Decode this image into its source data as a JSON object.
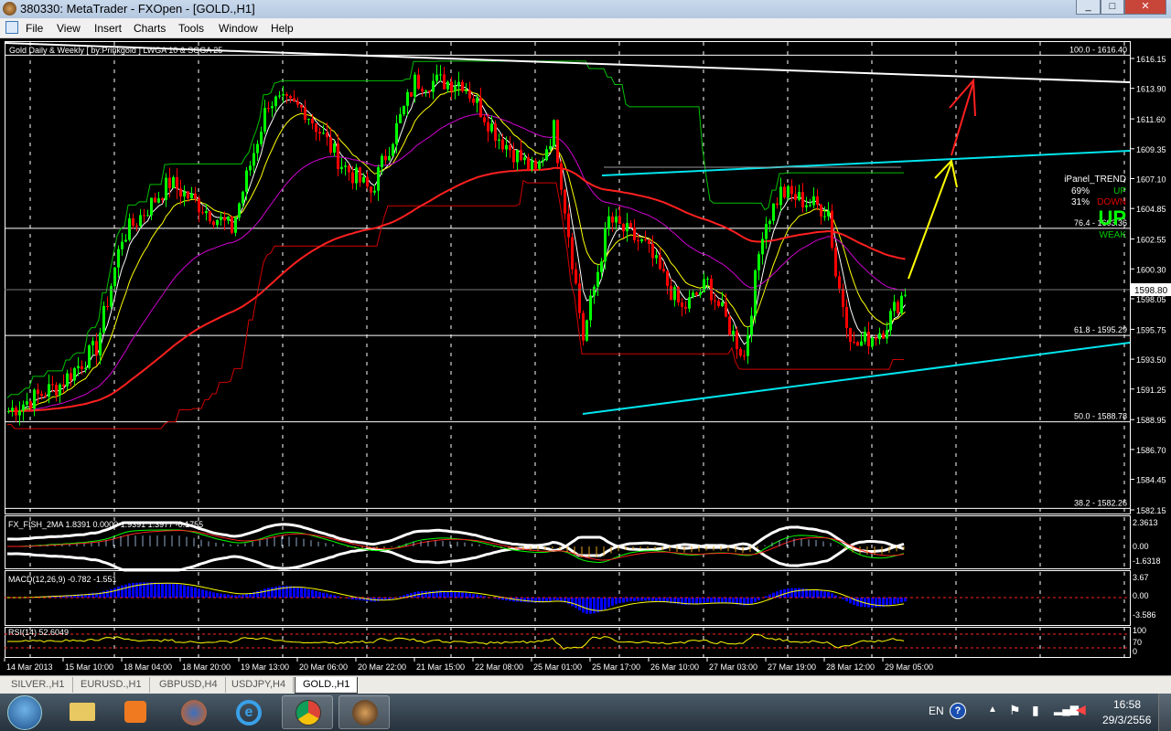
{
  "window": {
    "title": "380330: MetaTrader - FXOpen - [GOLD.,H1]",
    "min": "_",
    "max": "□",
    "close": "✕"
  },
  "menu": [
    "File",
    "View",
    "Insert",
    "Charts",
    "Tools",
    "Window",
    "Help"
  ],
  "chart": {
    "indicator_label": "Gold Daily & Weekly [ by:Prinkgold ] LWGA 10 & SGGA 25",
    "price_ticks": [
      "1616.15",
      "1613.90",
      "1611.60",
      "1609.35",
      "1607.10",
      "1604.85",
      "1602.55",
      "1600.30",
      "1598.05",
      "1595.75",
      "1593.50",
      "1591.25",
      "1588.95",
      "1586.70",
      "1584.45",
      "1582.15"
    ],
    "current_price": "1598.80",
    "fib_levels": [
      {
        "label": "100.0 - 1616.40",
        "price": 1616.4
      },
      {
        "label": "76.4 - 1603.36",
        "price": 1603.36
      },
      {
        "label": "61.8 - 1595.29",
        "price": 1595.29
      },
      {
        "label": "50.0 - 1588.78",
        "price": 1588.78
      },
      {
        "label": "38.2 - 1582.26",
        "price": 1582.26
      }
    ],
    "ipanel": {
      "title": "iPanel_TREND",
      "up_pct": "69%",
      "up": "UP",
      "down_pct": "31%",
      "down": "DOWN",
      "signal": "UP",
      "strength": "WEAK"
    },
    "time_labels": [
      "14 Mar 2013",
      "15 Mar 10:00",
      "18 Mar 04:00",
      "18 Mar 20:00",
      "19 Mar 13:00",
      "20 Mar 06:00",
      "20 Mar 22:00",
      "21 Mar 15:00",
      "22 Mar 08:00",
      "25 Mar 01:00",
      "25 Mar 17:00",
      "26 Mar 10:00",
      "27 Mar 03:00",
      "27 Mar 19:00",
      "28 Mar 12:00",
      "29 Mar 05:00"
    ],
    "colors": {
      "up": "#00ff00",
      "down": "#ff0000",
      "trend": "#00e5ee",
      "arrow_up": "#ffff00",
      "arrow_target": "#ff2020"
    }
  },
  "chart_data": {
    "type": "candlestick",
    "symbol": "GOLD.",
    "timeframe": "H1",
    "ylim": [
      1582.15,
      1616.15
    ],
    "close_waypoints": [
      [
        0,
        1589.6
      ],
      [
        14,
        1591.6
      ],
      [
        24,
        1594.4
      ],
      [
        31,
        1602.7
      ],
      [
        44,
        1606.8
      ],
      [
        61,
        1603.3
      ],
      [
        71,
        1613
      ],
      [
        81,
        1612.3
      ],
      [
        91,
        1608.2
      ],
      [
        99,
        1606.1
      ],
      [
        111,
        1614.4
      ],
      [
        124,
        1614.4
      ],
      [
        134,
        1610.2
      ],
      [
        144,
        1607.5
      ],
      [
        149,
        1610.9
      ],
      [
        157,
        1595.1
      ],
      [
        164,
        1604
      ],
      [
        174,
        1602
      ],
      [
        184,
        1597.2
      ],
      [
        191,
        1599.2
      ],
      [
        201,
        1593.7
      ],
      [
        206,
        1603.3
      ],
      [
        211,
        1606.1
      ],
      [
        224,
        1604.7
      ],
      [
        226,
        1599.9
      ],
      [
        231,
        1594.4
      ],
      [
        239,
        1595.8
      ],
      [
        245,
        1598.7
      ]
    ]
  },
  "indicators": {
    "fisher": {
      "label": "FX_FISH_2MA 1.8391 0.0000 1.9391 1.3977 -0.1755",
      "ticks": [
        "2.3613",
        "0.00",
        "-1.6318"
      ]
    },
    "macd": {
      "label": "MACD(12,26,9) -0.782 -1.551",
      "ticks": [
        "3.67",
        "0.00",
        "-3.586"
      ]
    },
    "rsi": {
      "label": "RSI(14) 52.6049",
      "ticks": [
        "100",
        "70",
        "0"
      ]
    }
  },
  "tabs": [
    "SILVER.,H1",
    "EURUSD.,H1",
    "GBPUSD,H4",
    "USDJPY,H4",
    "GOLD.,H1"
  ],
  "tray": {
    "lang": "EN",
    "time": "16:58",
    "date": "29/3/2556"
  }
}
